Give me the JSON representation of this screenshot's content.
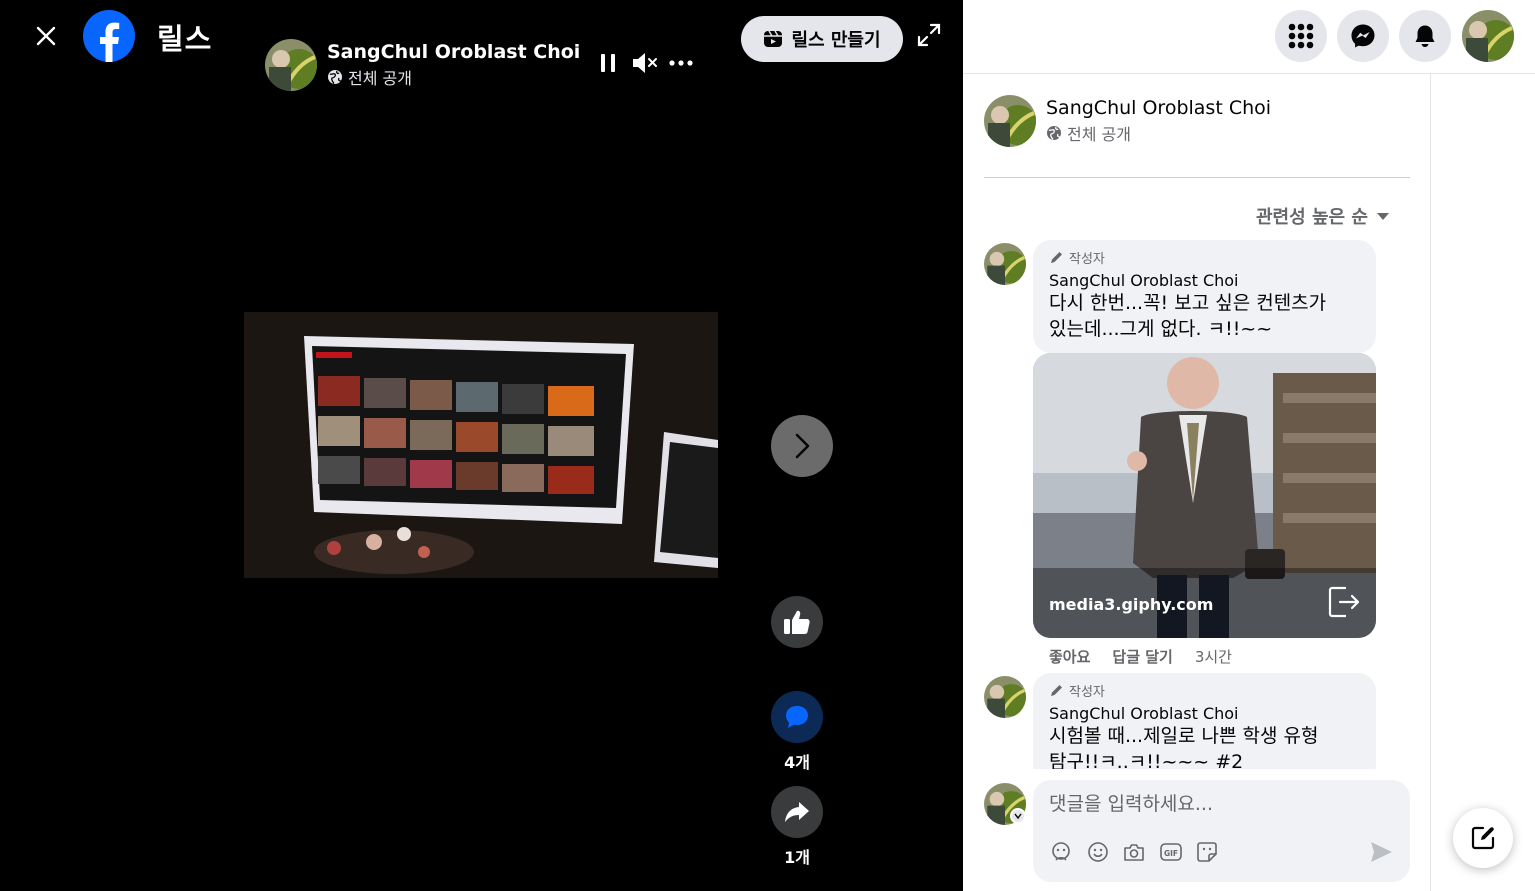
{
  "viewer": {
    "title": "릴스",
    "author_name": "SangChul Oroblast Choi",
    "privacy": "전체 공개",
    "create_reel_label": "릴스 만들기",
    "comment_count": "4개",
    "share_count": "1개"
  },
  "panel": {
    "author_name": "SangChul Oroblast Choi",
    "privacy": "전체 공개",
    "sort_label": "관련성 높은 순",
    "comments": [
      {
        "author_tag": "작성자",
        "name": "SangChul Oroblast Choi",
        "text_line1": "다시 한번...꼭! 보고 싶은 컨텐츠가",
        "text_line2": "있는데...그게 없다. ㅋ!!~~",
        "gif_source": "media3.giphy.com",
        "like_label": "좋아요",
        "reply_label": "답글 달기",
        "time": "3시간"
      },
      {
        "author_tag": "작성자",
        "name": "SangChul Oroblast Choi",
        "text_line1": "시험볼 때...제일로 나쁜 학생 유형",
        "text_line2": "탐구!!ㅋ..ㅋ!!~~~ #2"
      }
    ],
    "composer_placeholder": "댓글을 입력하세요..."
  },
  "colors": {
    "facebook_blue": "#0866ff",
    "comment_active": "#0866ff"
  }
}
